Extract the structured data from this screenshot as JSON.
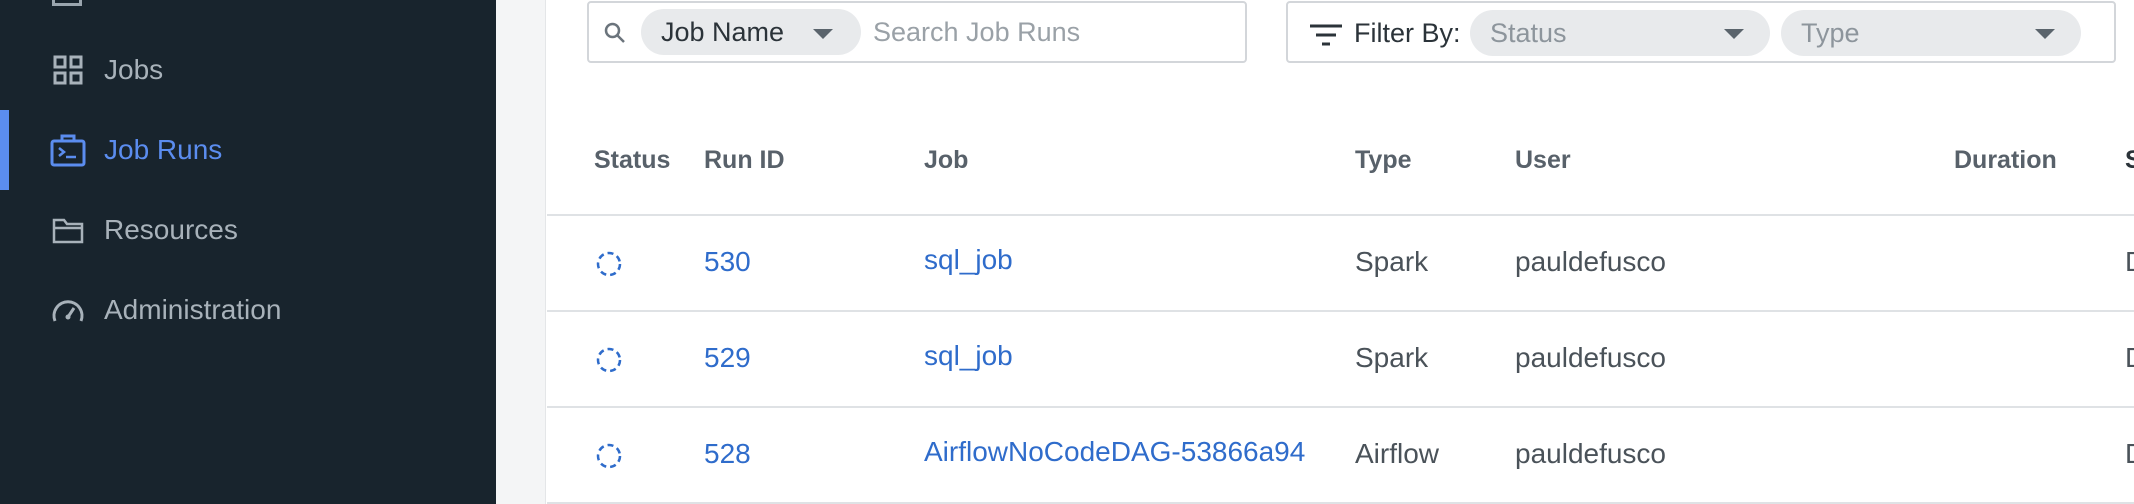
{
  "sidebar": {
    "items": [
      {
        "label": "Jobs",
        "icon": "grid-icon",
        "active": false
      },
      {
        "label": "Job Runs",
        "icon": "job-runs-icon",
        "active": true
      },
      {
        "label": "Resources",
        "icon": "folder-icon",
        "active": false
      },
      {
        "label": "Administration",
        "icon": "gauge-icon",
        "active": false
      }
    ]
  },
  "search": {
    "field_selector": "Job Name",
    "placeholder": "Search Job Runs"
  },
  "filter": {
    "label": "Filter By:",
    "status_placeholder": "Status",
    "type_placeholder": "Type"
  },
  "table": {
    "columns": [
      "Status",
      "Run ID",
      "Job",
      "Type",
      "User",
      "Duration",
      "S"
    ],
    "rows": [
      {
        "run_id": "530",
        "job": "sql_job",
        "type": "Spark",
        "user": "pauldefusco",
        "duration": "",
        "extra": "D"
      },
      {
        "run_id": "529",
        "job": "sql_job",
        "type": "Spark",
        "user": "pauldefusco",
        "duration": "",
        "extra": "D"
      },
      {
        "run_id": "528",
        "job": "AirflowNoCodeDAG-53866a94",
        "type": "Airflow",
        "user": "pauldefusco",
        "duration": "",
        "extra": "D"
      }
    ]
  },
  "colors": {
    "sidebar_bg": "#18242d",
    "accent": "#5b8def",
    "link": "#2f6ccb",
    "status_running": "#2f6ccb"
  }
}
